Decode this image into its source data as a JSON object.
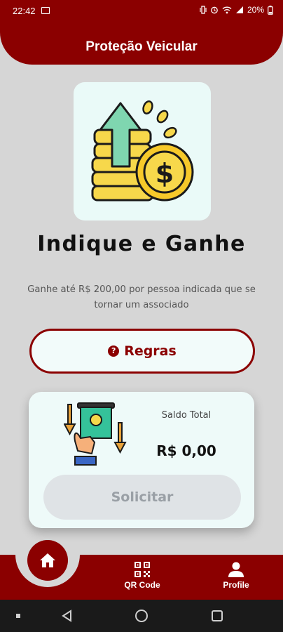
{
  "status_bar": {
    "time": "22:42",
    "battery": "20%",
    "icons": [
      "image-icon",
      "vibrate-icon",
      "alarm-icon",
      "wifi-icon",
      "signal-icon",
      "battery-icon"
    ]
  },
  "header": {
    "title": "Proteção Veicular"
  },
  "hero": {
    "illustration": "coins-arrow-up-illustration",
    "title": "Indique e Ganhe",
    "description": "Ganhe até R$ 200,00 por pessoa indicada que se tornar um associado"
  },
  "rules_button": {
    "icon": "question-circle-icon",
    "label": "Regras"
  },
  "balance": {
    "illustration": "cash-withdraw-illustration",
    "label": "Saldo Total",
    "value": "R$ 0,00",
    "request_label": "Solicitar",
    "request_enabled": false
  },
  "bottom_nav": {
    "items": [
      {
        "name": "home",
        "icon": "home-icon",
        "label": "",
        "active": true
      },
      {
        "name": "qr-code",
        "icon": "qr-code-icon",
        "label": "QR Code",
        "active": false
      },
      {
        "name": "profile",
        "icon": "person-icon",
        "label": "Profile",
        "active": false
      }
    ]
  },
  "colors": {
    "primary": "#8B0000",
    "background": "#D6D6D6",
    "card": "#EEFAF9",
    "disabled_button": "#DFE3E6",
    "disabled_text": "#9AA0A6"
  }
}
